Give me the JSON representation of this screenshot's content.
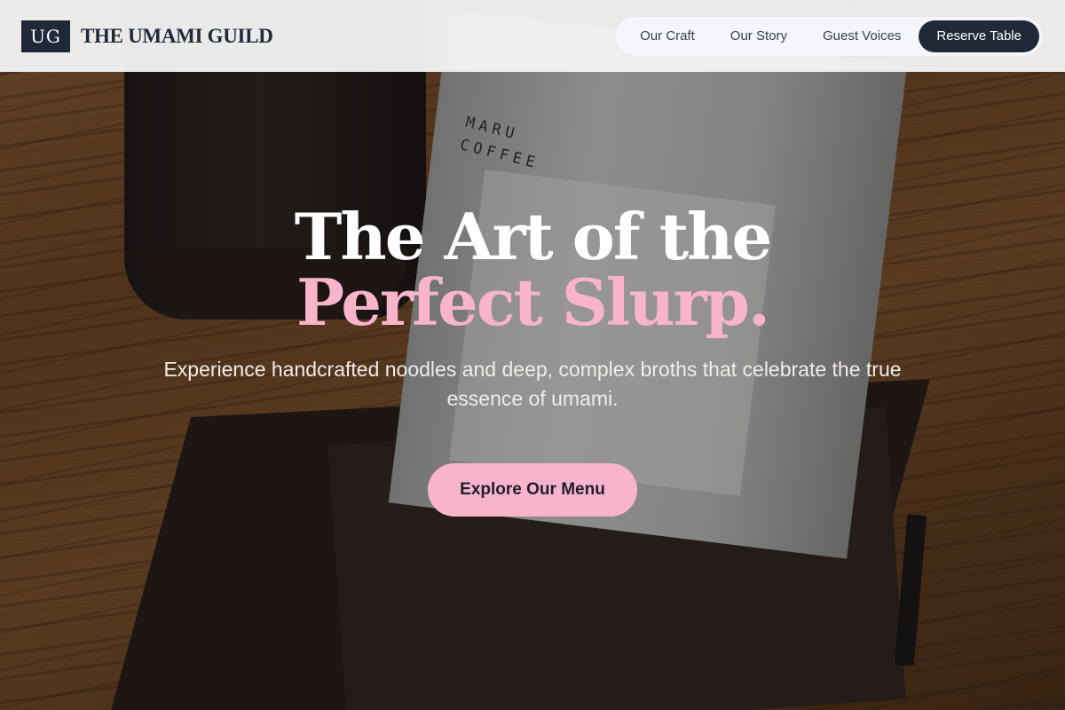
{
  "brand": {
    "logo_initials": "UG",
    "name": "THE UMAMI GUILD"
  },
  "nav": {
    "links": [
      {
        "label": "Our Craft"
      },
      {
        "label": "Our Story"
      },
      {
        "label": "Guest Voices"
      }
    ],
    "cta_label": "Reserve Table"
  },
  "hero": {
    "headline_line1": "The Art of the",
    "headline_line2": "Perfect Slurp.",
    "subtitle": "Experience handcrafted noodles and deep, complex broths that celebrate the true essence of umami.",
    "cta_label": "Explore Our Menu",
    "background_photo_text": "MARU\nCOFFEE"
  },
  "colors": {
    "accent_pink": "#f8b4cb",
    "navy": "#1f2937",
    "header_bg": "#f3f3f3"
  }
}
